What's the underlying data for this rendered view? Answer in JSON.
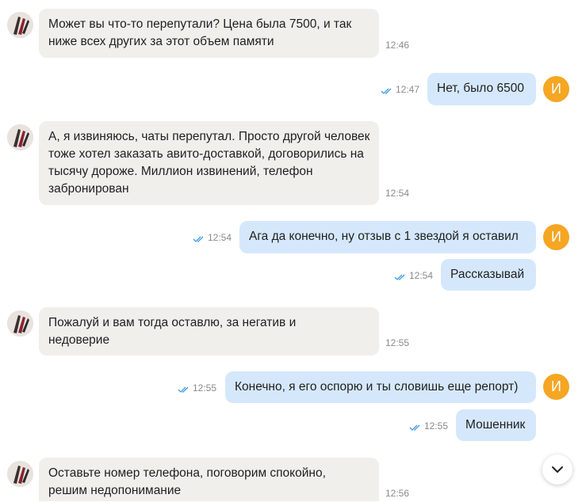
{
  "messages": [
    {
      "side": "in",
      "text": "Может вы что-то перепутали? Цена была 7500, и так ниже всех других за этот объем памяти",
      "time": "12:46"
    },
    {
      "side": "out",
      "text": "Нет, было 6500",
      "time": "12:47",
      "read": true
    },
    {
      "side": "in",
      "text": "А, я извиняюсь, чаты перепутал. Просто другой человек тоже хотел заказать авито-доставкой, договорились на тысячу дороже. Миллион извинений, телефон забронирован",
      "time": "12:54"
    },
    {
      "side": "out",
      "text": "Ага да конечно, ну отзыв с 1 звездой я оставил",
      "time": "12:54",
      "read": true
    },
    {
      "side": "out",
      "text": "Рассказывай",
      "time": "12:54",
      "read": true
    },
    {
      "side": "in",
      "text": "Пожалуй и вам тогда оставлю, за негатив и недоверие",
      "time": "12:55"
    },
    {
      "side": "out",
      "text": "Конечно, я его оспорю и ты словишь еще репорт)",
      "time": "12:55",
      "read": true
    },
    {
      "side": "out",
      "text": "Мошенник",
      "time": "12:55",
      "read": true
    },
    {
      "side": "in",
      "text": "Оставьте номер телефона, поговорим спокойно, решим недопонимание",
      "time": "12:56"
    }
  ],
  "user_avatar_initial": "И",
  "colors": {
    "incoming_bubble": "#f0efeb",
    "outgoing_bubble": "#d5e8fb",
    "avatar_orange": "#f5a623",
    "read_ticks": "#3f9be6",
    "timestamp": "#8a8a8a"
  },
  "icons": {
    "read_receipt": "double-check-icon",
    "scroll_down": "chevron-down-icon",
    "contact_avatar": "contact-avatar-photo"
  }
}
